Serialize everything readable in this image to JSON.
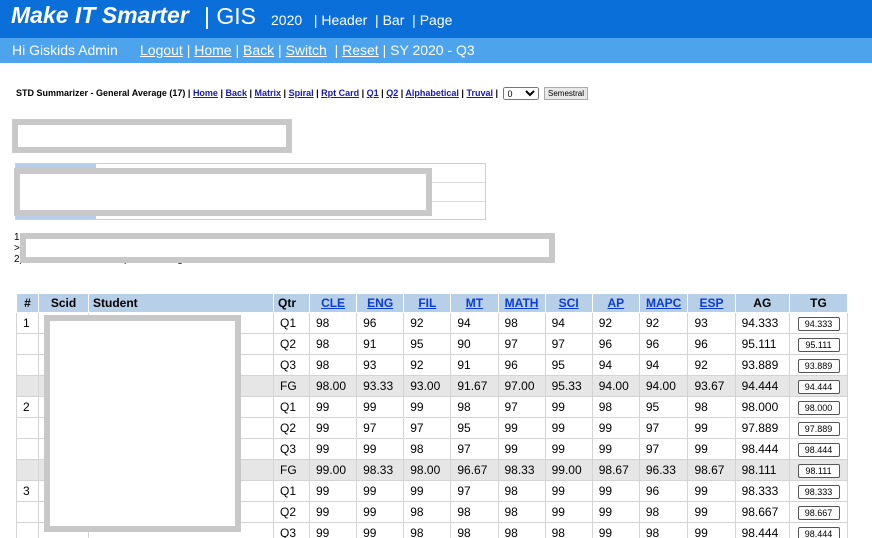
{
  "header": {
    "brand": "Make IT Smarter",
    "brand_suffix": "| GIS",
    "nav_year": "2020",
    "nav_items": [
      "Header",
      "Bar",
      "Page"
    ]
  },
  "subbar": {
    "greeting": "Hi Giskids Admin",
    "links": [
      "Logout",
      "Home",
      "Back",
      "Switch",
      "Reset"
    ],
    "sy": "SY 2020 - Q3"
  },
  "summarizer": {
    "title": "STD Summarizer - General Average (17) |",
    "links": [
      "Home",
      "Back",
      "Matrix",
      "Spiral",
      "Rpt Card",
      "Q1",
      "Q2",
      "Alphabetical",
      "Truval"
    ],
    "select_value": "0",
    "button": "Semestral"
  },
  "notes": {
    "n1": "1",
    "n1b": ">",
    "n2": "2) Press Summarize to update Average in Database."
  },
  "table": {
    "headers": [
      "#",
      "Scid",
      "Student",
      "Qtr",
      "CLE",
      "ENG",
      "FIL",
      "MT",
      "MATH",
      "SCI",
      "AP",
      "MAPC",
      "ESP",
      "AG",
      "TG"
    ],
    "rows": [
      {
        "num": "1",
        "qtr": "Q1",
        "g": [
          "98",
          "96",
          "92",
          "94",
          "98",
          "94",
          "92",
          "92",
          "93"
        ],
        "ag": "94.333",
        "tg": "94.333",
        "fg": false
      },
      {
        "num": "",
        "qtr": "Q2",
        "g": [
          "98",
          "91",
          "95",
          "90",
          "97",
          "97",
          "96",
          "96",
          "96"
        ],
        "ag": "95.111",
        "tg": "95.111",
        "fg": false
      },
      {
        "num": "",
        "qtr": "Q3",
        "g": [
          "98",
          "93",
          "92",
          "91",
          "96",
          "95",
          "94",
          "94",
          "92"
        ],
        "ag": "93.889",
        "tg": "93.889",
        "fg": false
      },
      {
        "num": "",
        "qtr": "FG",
        "g": [
          "98.00",
          "93.33",
          "93.00",
          "91.67",
          "97.00",
          "95.33",
          "94.00",
          "94.00",
          "93.67"
        ],
        "ag": "94.444",
        "tg": "94.444",
        "fg": true
      },
      {
        "num": "2",
        "qtr": "Q1",
        "g": [
          "99",
          "99",
          "99",
          "98",
          "97",
          "99",
          "98",
          "95",
          "98"
        ],
        "ag": "98.000",
        "tg": "98.000",
        "fg": false
      },
      {
        "num": "",
        "qtr": "Q2",
        "g": [
          "99",
          "97",
          "97",
          "95",
          "99",
          "99",
          "99",
          "97",
          "99"
        ],
        "ag": "97.889",
        "tg": "97.889",
        "fg": false
      },
      {
        "num": "",
        "qtr": "Q3",
        "g": [
          "99",
          "99",
          "98",
          "97",
          "99",
          "99",
          "99",
          "97",
          "99"
        ],
        "ag": "98.444",
        "tg": "98.444",
        "fg": false
      },
      {
        "num": "",
        "qtr": "FG",
        "g": [
          "99.00",
          "98.33",
          "98.00",
          "96.67",
          "98.33",
          "99.00",
          "98.67",
          "96.33",
          "98.67"
        ],
        "ag": "98.111",
        "tg": "98.111",
        "fg": true
      },
      {
        "num": "3",
        "qtr": "Q1",
        "g": [
          "99",
          "99",
          "99",
          "97",
          "98",
          "99",
          "99",
          "96",
          "99"
        ],
        "ag": "98.333",
        "tg": "98.333",
        "fg": false
      },
      {
        "num": "",
        "qtr": "Q2",
        "g": [
          "99",
          "99",
          "98",
          "98",
          "98",
          "99",
          "99",
          "98",
          "99"
        ],
        "ag": "98.667",
        "tg": "98.667",
        "fg": false
      },
      {
        "num": "",
        "qtr": "Q3",
        "g": [
          "99",
          "99",
          "98",
          "98",
          "98",
          "98",
          "99",
          "98",
          "99"
        ],
        "ag": "98.444",
        "tg": "98.444",
        "fg": false
      }
    ]
  },
  "colors": {
    "topbar": "#0a6fd8",
    "subbar": "#4da3ec",
    "table_header": "#b8cfe8",
    "fg_row": "#e6e6e6",
    "link": "#0a3cd6",
    "redaction": "#c8c8c8"
  }
}
